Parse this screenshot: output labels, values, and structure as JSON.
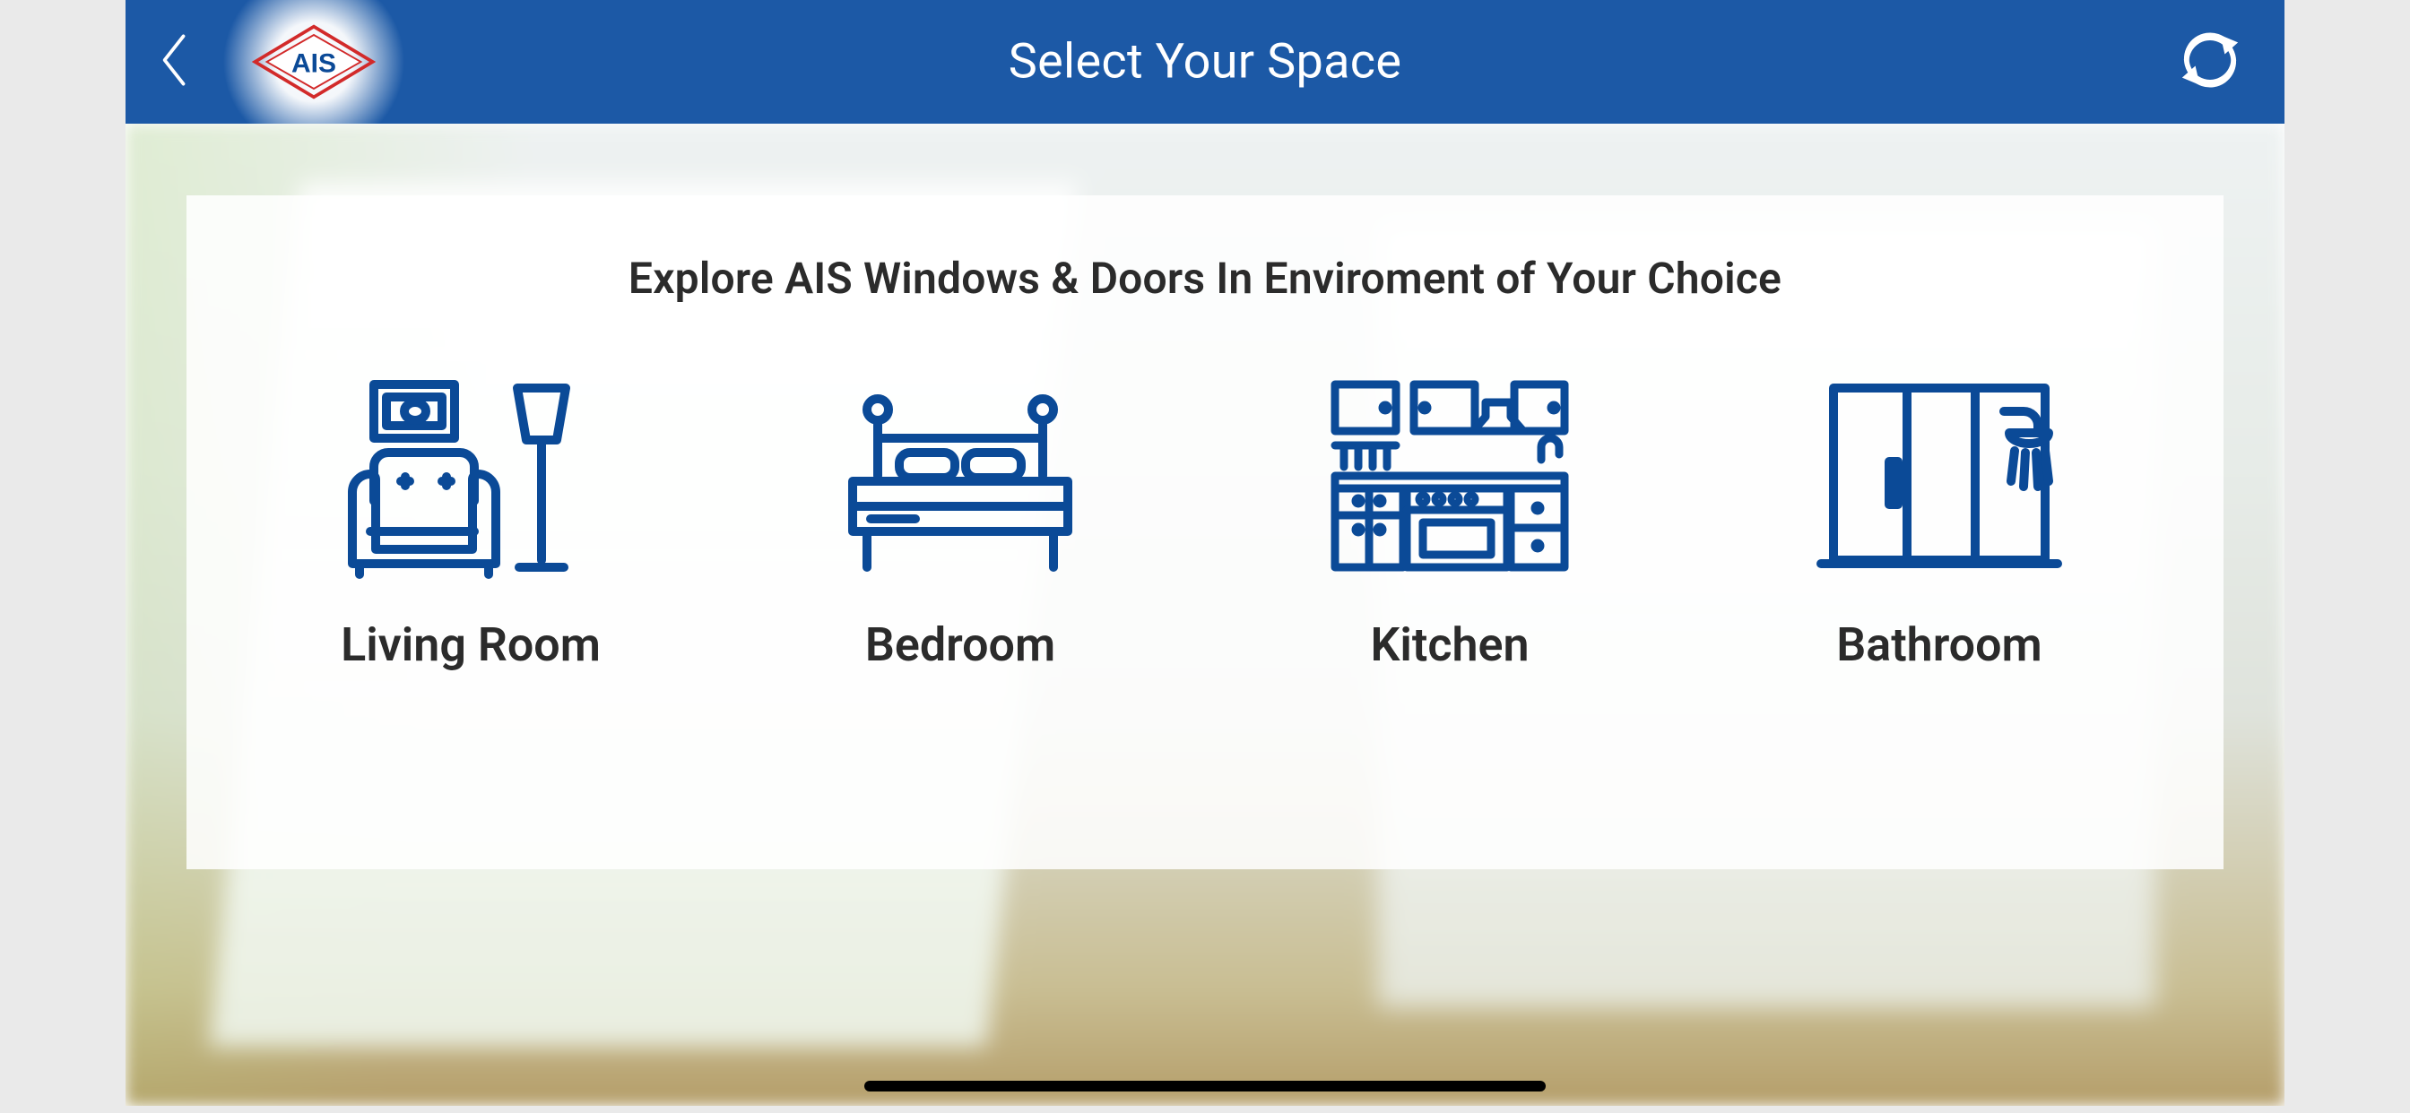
{
  "header": {
    "title": "Select Your Space",
    "logo_text": "AIS"
  },
  "content": {
    "subtitle": "Explore AIS Windows & Doors In Enviroment of Your Choice",
    "spaces": [
      {
        "label": "Living Room",
        "icon": "livingroom-icon"
      },
      {
        "label": "Bedroom",
        "icon": "bedroom-icon"
      },
      {
        "label": "Kitchen",
        "icon": "kitchen-icon"
      },
      {
        "label": "Bathroom",
        "icon": "bathroom-icon"
      }
    ]
  },
  "colors": {
    "brand_blue": "#1c59a6",
    "icon_blue": "#0b4a97",
    "text_dark": "#2b2b2b"
  }
}
